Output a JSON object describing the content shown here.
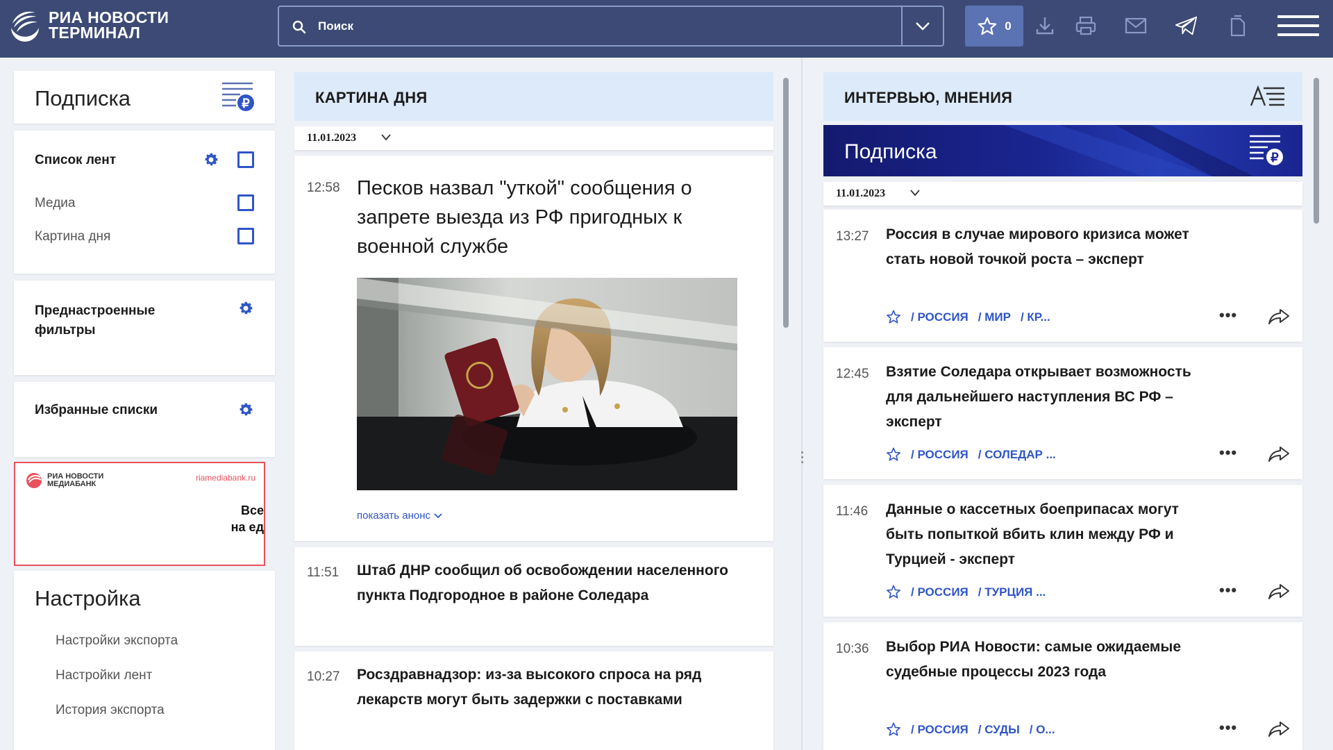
{
  "header": {
    "logo_line1": "РИА НОВОСТИ",
    "logo_line2": "ТЕРМИНАЛ",
    "search_placeholder": "Поиск",
    "favorites_count": "0",
    "colors": {
      "bar": "#3c4a75",
      "accent": "#5b72b3"
    }
  },
  "left": {
    "subscription_title": "Подписка",
    "feeds": {
      "title": "Список лент",
      "items": [
        "Медиа",
        "Картина дня"
      ]
    },
    "presets_title_line1": "Преднастроенные",
    "presets_title_line2": "фильтры",
    "favorites_title": "Избранные списки",
    "banner": {
      "logo_line1": "РИА НОВОСТИ",
      "logo_line2": "МЕДИАБАНК",
      "url": "riamediabank.ru",
      "text_line1": "Все",
      "text_line2": "на ед"
    },
    "settings": {
      "title": "Настройка",
      "links": [
        "Настройки экспорта",
        "Настройки лент",
        "История экспорта"
      ]
    }
  },
  "middle": {
    "column_title": "КАРТИНА ДНЯ",
    "date": "11.01.2023",
    "main_news": {
      "time": "12:58",
      "title": "Песков назвал \"уткой\" сообщения о запрете выезда из РФ пригодных к военной службе",
      "show_announce": "показать анонс"
    },
    "news": [
      {
        "time": "11:51",
        "title": "Штаб ДНР сообщил об освобождении населенного пункта Подгородное в районе Соледара"
      },
      {
        "time": "10:27",
        "title": "Росздравнадзор: из-за высокого спроса на ряд лекарств могут быть задержки с поставками"
      }
    ]
  },
  "right": {
    "column_title": "ИНТЕРВЬЮ, МНЕНИЯ",
    "subscription_title": "Подписка",
    "date": "11.01.2023",
    "news": [
      {
        "time": "13:27",
        "title": "Россия в случае мирового кризиса может стать новой точкой роста – эксперт",
        "tags": [
          "/ РОССИЯ",
          "/ МИР",
          "/ КР..."
        ]
      },
      {
        "time": "12:45",
        "title": "Взятие Соледара открывает возможность для дальнейшего наступления ВС РФ – эксперт",
        "tags": [
          "/ РОССИЯ",
          "/ СОЛЕДАР ..."
        ]
      },
      {
        "time": "11:46",
        "title": "Данные о кассетных боеприпасах могут быть попыткой вбить клин между РФ и Турцией - эксперт",
        "tags": [
          "/ РОССИЯ",
          "/ ТУРЦИЯ ..."
        ]
      },
      {
        "time": "10:36",
        "title": "Выбор РИА Новости: самые ожидаемые судебные процессы 2023 года",
        "tags": [
          "/ РОССИЯ",
          "/ СУДЫ",
          "/ О..."
        ]
      }
    ]
  }
}
